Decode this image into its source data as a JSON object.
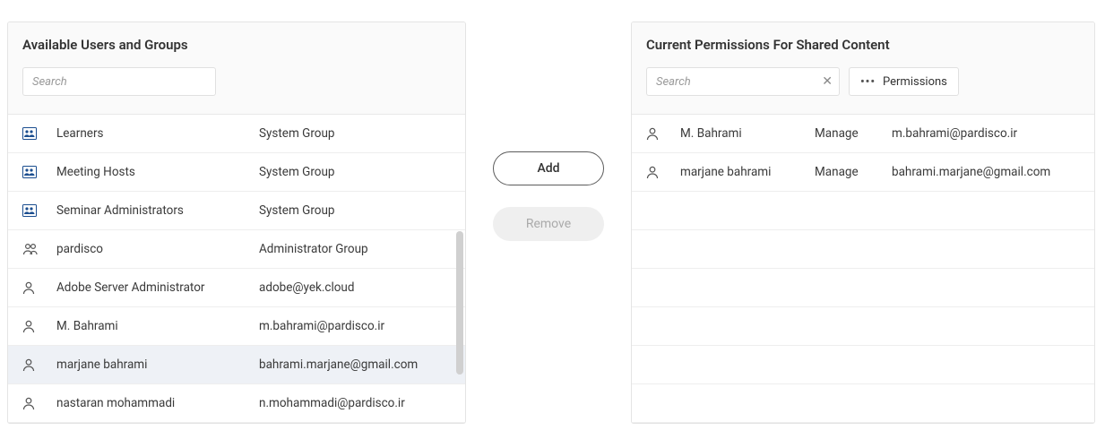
{
  "left": {
    "title": "Available Users and Groups",
    "search_placeholder": "Search",
    "rows": [
      {
        "icon": "group",
        "name": "Learners",
        "detail": "System Group",
        "selected": false
      },
      {
        "icon": "group",
        "name": "Meeting Hosts",
        "detail": "System Group",
        "selected": false
      },
      {
        "icon": "group",
        "name": "Seminar Administrators",
        "detail": "System Group",
        "selected": false
      },
      {
        "icon": "users",
        "name": "pardisco",
        "detail": "Administrator Group",
        "selected": false
      },
      {
        "icon": "user",
        "name": "Adobe Server Administrator",
        "detail": "adobe@yek.cloud",
        "selected": false
      },
      {
        "icon": "user",
        "name": "M. Bahrami",
        "detail": "m.bahrami@pardisco.ir",
        "selected": false
      },
      {
        "icon": "user",
        "name": "marjane bahrami",
        "detail": "bahrami.marjane@gmail.com",
        "selected": true
      },
      {
        "icon": "user",
        "name": "nastaran mohammadi",
        "detail": "n.mohammadi@pardisco.ir",
        "selected": false
      }
    ]
  },
  "actions": {
    "add": "Add",
    "remove": "Remove"
  },
  "right": {
    "title": "Current Permissions For Shared Content",
    "search_placeholder": "Search",
    "permissions_button": "Permissions",
    "rows": [
      {
        "icon": "user",
        "name": "M. Bahrami",
        "permission": "Manage",
        "email": "m.bahrami@pardisco.ir"
      },
      {
        "icon": "user",
        "name": "marjane bahrami",
        "permission": "Manage",
        "email": "bahrami.marjane@gmail.com"
      }
    ],
    "empty_rows": 6
  }
}
